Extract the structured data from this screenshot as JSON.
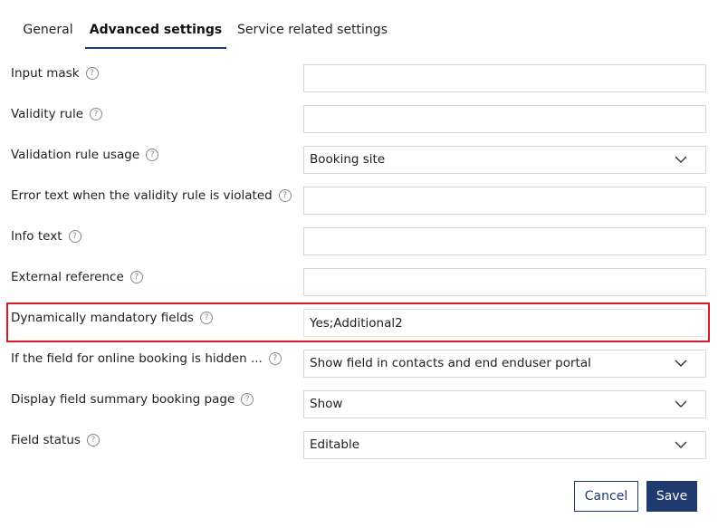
{
  "tabs": [
    {
      "label": "General",
      "active": false
    },
    {
      "label": "Advanced settings",
      "active": true
    },
    {
      "label": "Service related settings",
      "active": false
    }
  ],
  "help_glyph": "?",
  "fields": {
    "input_mask": {
      "label": "Input mask",
      "value": ""
    },
    "validity_rule": {
      "label": "Validity rule",
      "value": ""
    },
    "validation_rule_usage": {
      "label": "Validation rule usage",
      "value": "Booking site"
    },
    "error_text": {
      "label": "Error text when the validity rule is violated",
      "value": ""
    },
    "info_text": {
      "label": "Info text",
      "value": ""
    },
    "external_reference": {
      "label": "External reference",
      "value": ""
    },
    "dynamically_mandatory": {
      "label": "Dynamically mandatory fields",
      "value": "Yes;Additional2"
    },
    "hidden_behavior": {
      "label": "If the field for online booking is hidden ...",
      "value": "Show field in contacts and end enduser portal"
    },
    "display_summary": {
      "label": "Display field summary booking page",
      "value": "Show"
    },
    "field_status": {
      "label": "Field status",
      "value": "Editable"
    }
  },
  "buttons": {
    "cancel": "Cancel",
    "save": "Save"
  },
  "colors": {
    "accent": "#1e3a6e",
    "highlight": "#d31b2c",
    "border": "#d7d7d7"
  },
  "icons": {
    "help": "help-circle-icon",
    "chevron": "chevron-down-icon"
  }
}
